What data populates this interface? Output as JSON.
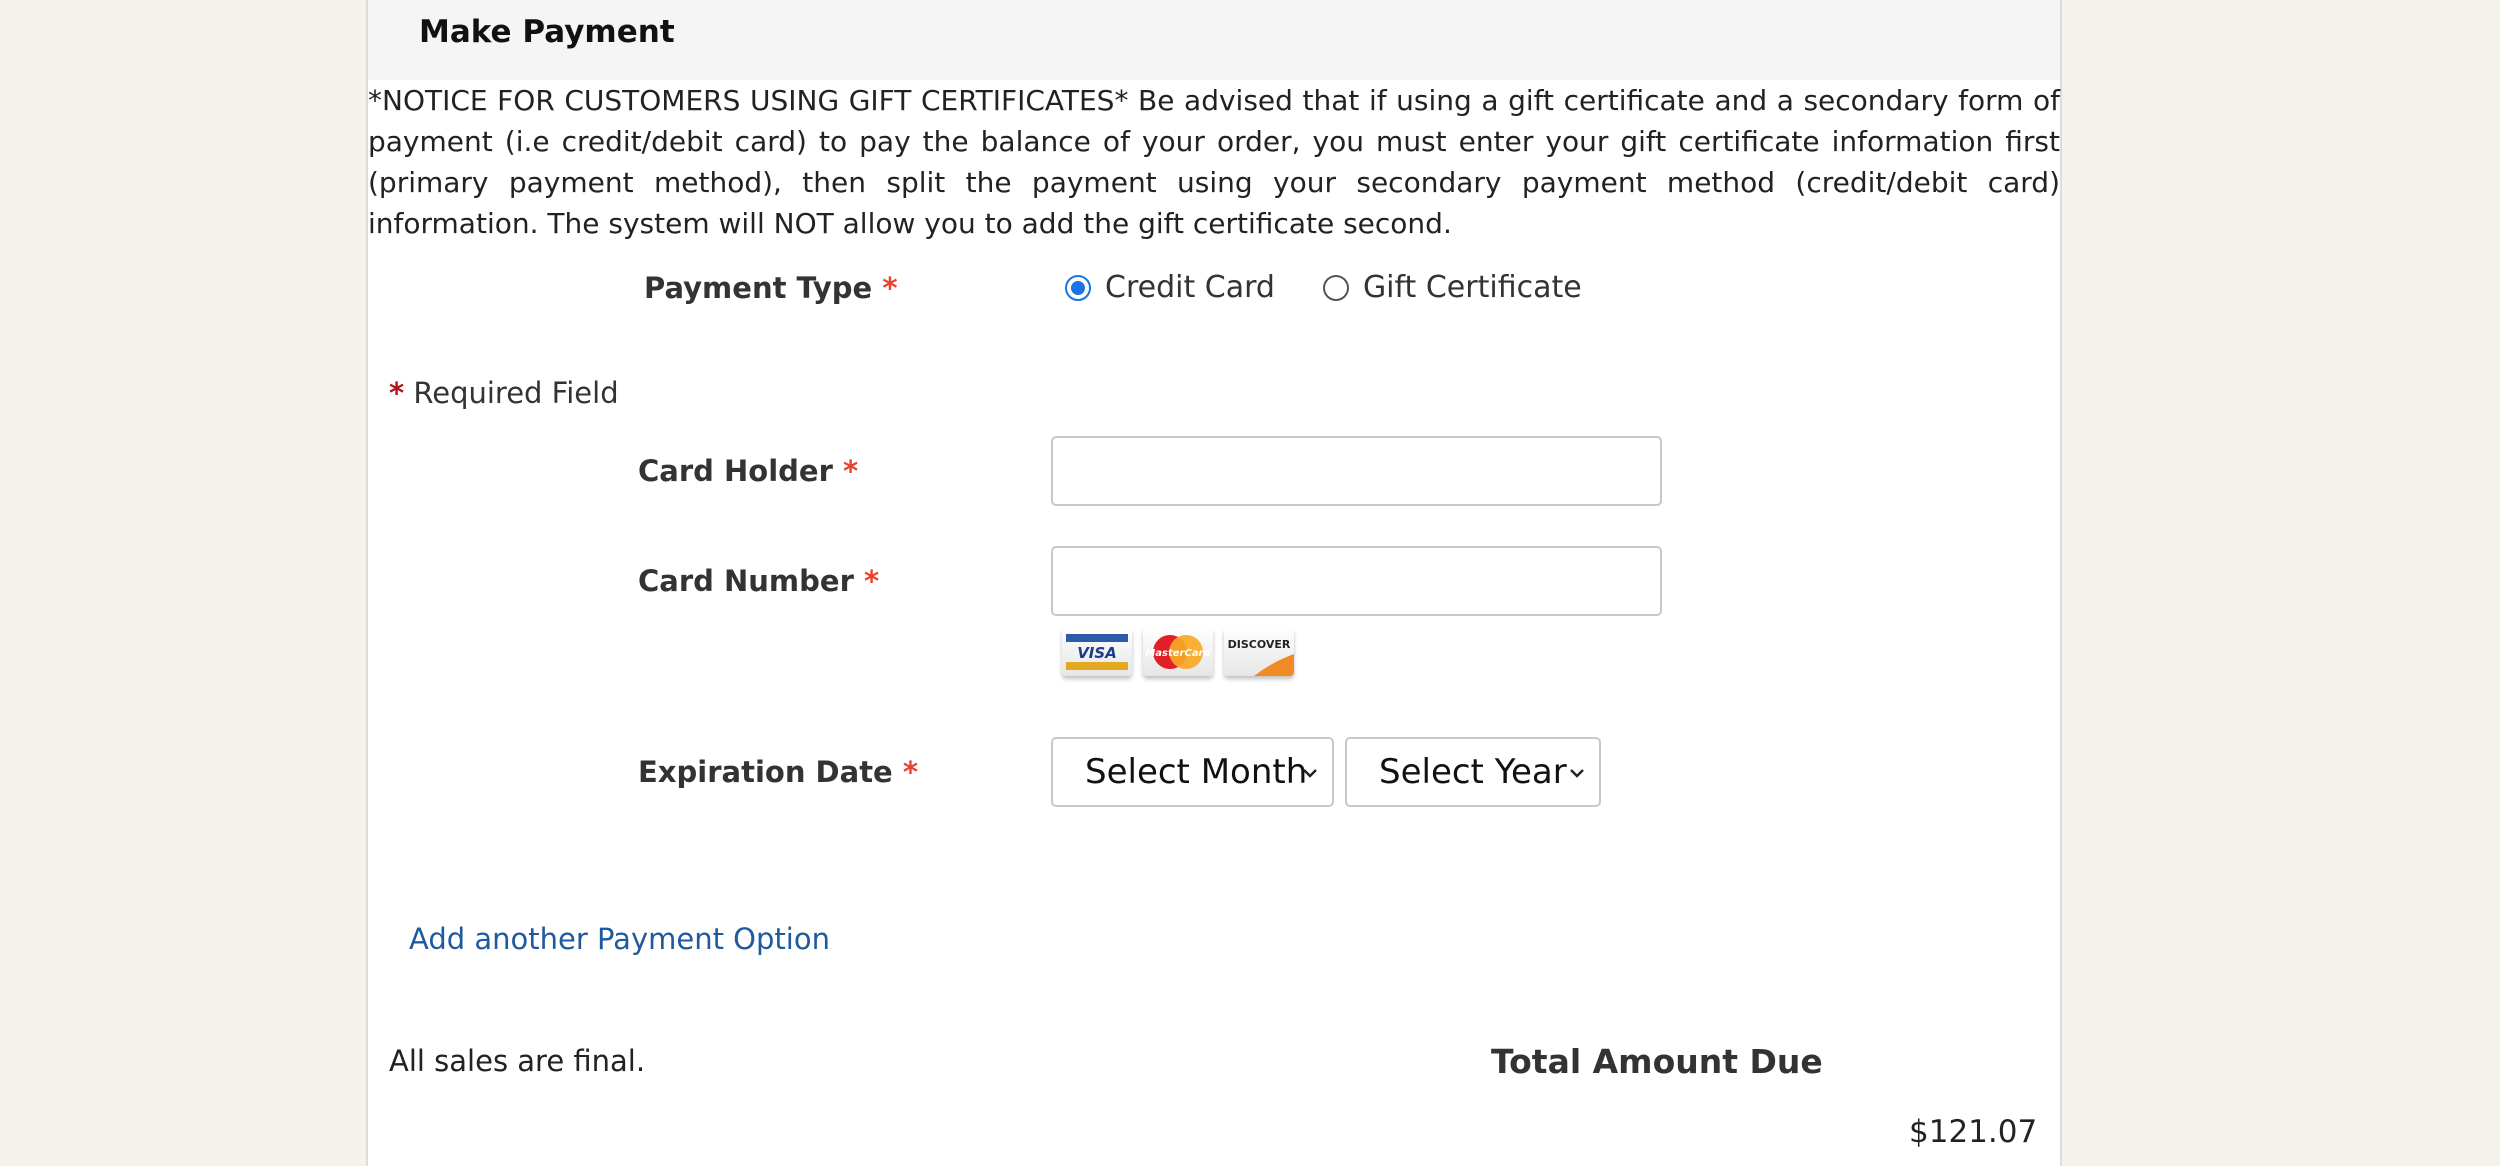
{
  "header": {
    "title": "Make Payment"
  },
  "notice": "*NOTICE FOR CUSTOMERS USING GIFT CERTIFICATES* Be advised that if using a gift certificate and a secondary form of payment (i.e credit/debit card) to pay the balance of your order, you must enter your gift certificate information first (primary payment method), then split the payment using your secondary payment method (credit/debit card) information. The system will NOT allow you to add the gift certificate second.",
  "payment_type": {
    "label": "Payment Type",
    "required_mark": "*",
    "options": [
      {
        "label": "Credit Card",
        "selected": true
      },
      {
        "label": "Gift Certificate",
        "selected": false
      }
    ]
  },
  "required_note": {
    "mark": "*",
    "text": "Required Field"
  },
  "card_holder": {
    "label": "Card Holder",
    "required_mark": "*",
    "value": ""
  },
  "card_number": {
    "label": "Card Number",
    "required_mark": "*",
    "value": "",
    "accepted_cards": [
      "VISA",
      "MasterCard",
      "DISCOVER"
    ]
  },
  "expiration": {
    "label": "Expiration Date",
    "required_mark": "*",
    "month_selected": "Select Month",
    "year_selected": "Select Year"
  },
  "add_payment_link": "Add another Payment Option",
  "sales_note": "All sales are final.",
  "total": {
    "label": "Total Amount Due",
    "value": "$121.07"
  },
  "colors": {
    "page_bg": "#f5f1eb",
    "header_bg": "#f5f5f5",
    "required_red": "#e8432e",
    "link_blue": "#1f5a9e",
    "radio_blue": "#1a73e8"
  }
}
